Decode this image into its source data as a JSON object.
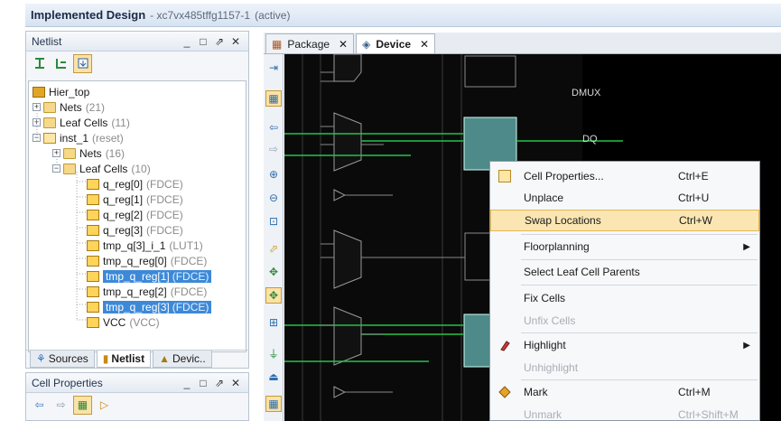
{
  "window": {
    "title": "Implemented Design",
    "part": "- xc7vx485tffg1157-1",
    "status": "(active)"
  },
  "netlist": {
    "panel_title": "Netlist",
    "controls": {
      "minimize": "_",
      "restore": "□",
      "float": "⇗",
      "close": "✕"
    },
    "tree": [
      {
        "label": "Hier_top",
        "meta": ""
      },
      {
        "label": "Nets",
        "meta": "(21)"
      },
      {
        "label": "Leaf Cells",
        "meta": "(11)"
      },
      {
        "label": "inst_1",
        "meta": "(reset)"
      },
      {
        "label": "Nets",
        "meta": "(16)"
      },
      {
        "label": "Leaf Cells",
        "meta": "(10)"
      },
      {
        "label": "q_reg[0]",
        "meta": "(FDCE)"
      },
      {
        "label": "q_reg[1]",
        "meta": "(FDCE)"
      },
      {
        "label": "q_reg[2]",
        "meta": "(FDCE)"
      },
      {
        "label": "q_reg[3]",
        "meta": "(FDCE)"
      },
      {
        "label": "tmp_q[3]_i_1",
        "meta": "(LUT1)"
      },
      {
        "label": "tmp_q_reg[0]",
        "meta": "(FDCE)"
      },
      {
        "label": "tmp_q_reg[1]",
        "meta": "(FDCE)"
      },
      {
        "label": "tmp_q_reg[2]",
        "meta": "(FDCE)"
      },
      {
        "label": "tmp_q_reg[3]",
        "meta": "(FDCE)"
      },
      {
        "label": "VCC",
        "meta": "(VCC)"
      }
    ],
    "tabs": [
      "Sources",
      "Netlist",
      "Devic.."
    ]
  },
  "cell_properties": {
    "panel_title": "Cell Properties"
  },
  "device": {
    "tabs": [
      "Package",
      "Device"
    ],
    "close_glyph": "✕",
    "canvas_labels": [
      "DMUX",
      "DQ"
    ]
  },
  "context_menu": {
    "items": [
      {
        "label": "Cell Properties...",
        "shortcut": "Ctrl+E",
        "disabled": false
      },
      {
        "label": "Unplace",
        "shortcut": "Ctrl+U",
        "disabled": false
      },
      {
        "label": "Swap Locations",
        "shortcut": "Ctrl+W",
        "disabled": false,
        "highlighted": true
      },
      {
        "label": "Floorplanning",
        "shortcut": "",
        "submenu": true
      },
      {
        "label": "Select Leaf Cell Parents",
        "shortcut": ""
      },
      {
        "label": "Fix Cells",
        "shortcut": ""
      },
      {
        "label": "Unfix Cells",
        "shortcut": "",
        "disabled": true
      },
      {
        "label": "Highlight",
        "shortcut": "",
        "submenu": true
      },
      {
        "label": "Unhighlight",
        "shortcut": "",
        "disabled": true
      },
      {
        "label": "Mark",
        "shortcut": "Ctrl+M"
      },
      {
        "label": "Unmark",
        "shortcut": "Ctrl+Shift+M",
        "disabled": true
      }
    ],
    "submenu_arrow": "▶"
  },
  "colors": {
    "selection": "#3d89d8",
    "highlight": "#fbe6b3",
    "canvas": "#000000",
    "net_green": "#22c34a"
  }
}
